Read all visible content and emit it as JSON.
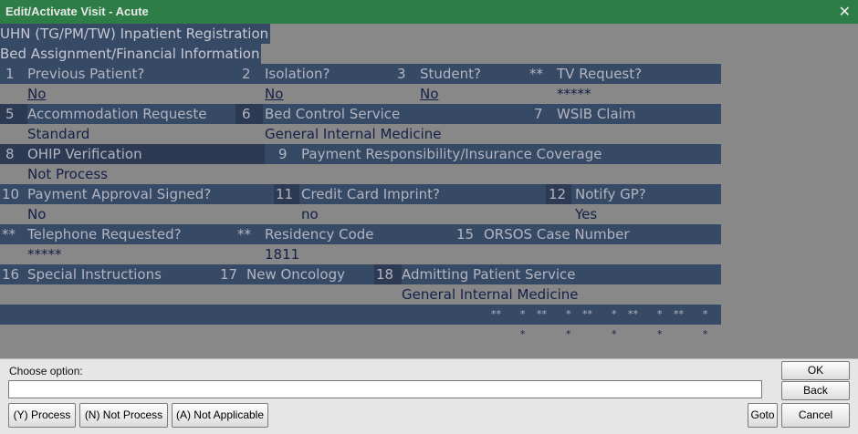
{
  "window": {
    "title": "Edit/Activate Visit - Acute",
    "close_glyph": "✕"
  },
  "screen": {
    "header1": "UHN (TG/PM/TW) Inpatient Registration",
    "header2": "Bed Assignment/Financial Information",
    "row1": {
      "n1": "1",
      "f1": "Previous Patient?",
      "v1": "No",
      "n2": "2",
      "f2": "Isolation?",
      "v2": "No",
      "n3": "3",
      "f3": "Student?",
      "v3": "No",
      "n4": "**",
      "f4": "TV Request?",
      "v4": "*****"
    },
    "row2": {
      "n1": "5",
      "f1": "Accommodation Requeste",
      "v1": "Standard",
      "n2": "6",
      "f2": "Bed Control Service",
      "v2": "General Internal Medicine",
      "n3": "7",
      "f3": "WSIB Claim",
      "v3": ""
    },
    "row3": {
      "n1": "8",
      "f1": "OHIP Verification",
      "v1": "Not Process",
      "n2": "9",
      "f2": "Payment Responsibility/Insurance Coverage",
      "v2": ""
    },
    "row4": {
      "n1": "10",
      "f1": "Payment Approval Signed?",
      "v1": "No",
      "n2": "11",
      "f2": "Credit Card Imprint?",
      "v2": "no",
      "n3": "12",
      "f3": "Notify GP?",
      "v3": "Yes"
    },
    "row5": {
      "n1": "**",
      "f1": "Telephone Requested?",
      "v1": "*****",
      "n2": "**",
      "f2": "Residency Code",
      "v2": "1811",
      "n3": "15",
      "f3": "ORSOS Case Number",
      "v3": ""
    },
    "row6": {
      "n1": "16",
      "f1": "Special Instructions",
      "v1": "",
      "n2": "17",
      "f2": "New Oncology",
      "v2": "",
      "n3": "18",
      "f3": "Admitting Patient Service",
      "v3": "General Internal Medicine"
    },
    "row7": {
      "labels": [
        "**",
        "*",
        "**",
        "*",
        "**",
        "*",
        "**",
        "*",
        "**",
        "*"
      ],
      "values": [
        "*",
        "*",
        "*",
        "*",
        "*"
      ]
    }
  },
  "prompt": {
    "label": "Choose option:",
    "input_value": "",
    "options": [
      "(Y) Process",
      "(N) Not Process",
      "(A) Not Applicable"
    ],
    "ok": "OK",
    "back": "Back",
    "goto": "Goto",
    "cancel": "Cancel"
  }
}
